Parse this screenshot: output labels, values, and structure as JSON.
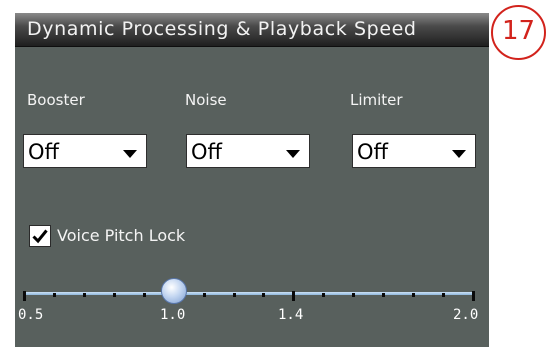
{
  "panel": {
    "title": "Dynamic Processing & Playback Speed"
  },
  "booster": {
    "label": "Booster",
    "value": "Off"
  },
  "noise": {
    "label": "Noise",
    "value": "Off"
  },
  "limiter": {
    "label": "Limiter",
    "value": "Off"
  },
  "voice_pitch_lock": {
    "label": "Voice Pitch Lock",
    "checked": true
  },
  "speed_slider": {
    "value": 1.0,
    "min": 0.5,
    "max": 2.0,
    "labels": [
      "0.5",
      "1.0",
      "1.4",
      "2.0"
    ]
  },
  "callout": {
    "number": "17",
    "color": "#d2231c"
  }
}
